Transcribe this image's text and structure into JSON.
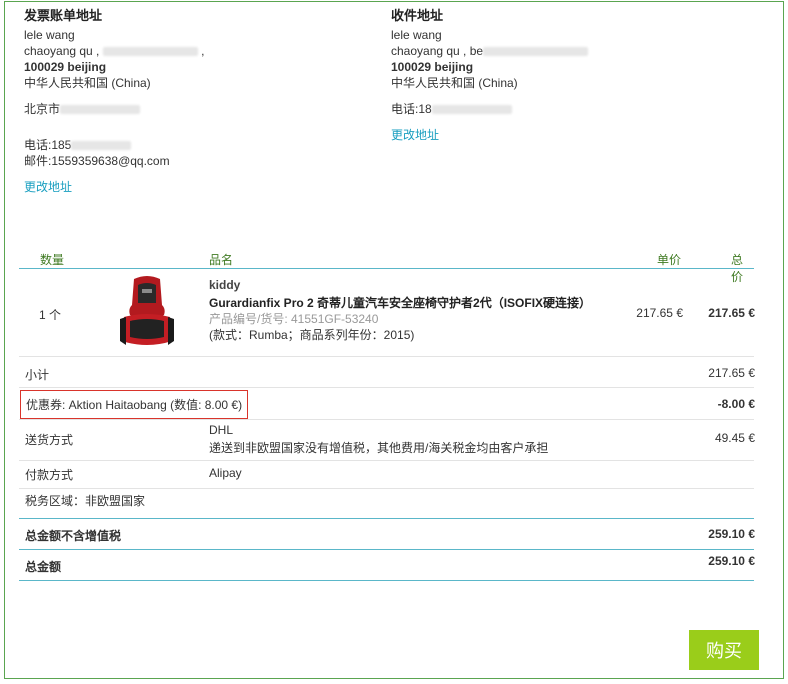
{
  "billing": {
    "title": "发票账单地址",
    "name": "lele wang",
    "street": "chaoyang qu , ",
    "street_tail": " ,",
    "postal_city": "100029 beijing",
    "country": "中华人民共和国 (China)",
    "local_address": "北京市",
    "phone": "电话:185",
    "email": "邮件:1559359638@qq.com",
    "edit_link": "更改地址"
  },
  "shipping": {
    "title": "收件地址",
    "name": "lele wang",
    "street": "chaoyang qu , be",
    "postal_city": "100029 beijing",
    "country": "中华人民共和国 (China)",
    "phone": "电话:18",
    "edit_link": "更改地址"
  },
  "table": {
    "headers": {
      "qty": "数量",
      "name": "品名",
      "unit_price": "单价",
      "total": "总价"
    },
    "product": {
      "qty": "1 个",
      "brand": "kiddy",
      "title": "Gurardianfix Pro 2 奇蒂儿童汽车安全座椅守护者2代（ISOFIX硬连接）",
      "sku": "产品编号/货号: 41551GF-53240",
      "variant": "(款式：Rumba；商品系列年份：2015)",
      "unit_price": "217.65 €",
      "total": "217.65 €"
    }
  },
  "summary": {
    "subtotal_label": "小计",
    "subtotal_value": "217.65 €",
    "coupon_label": "优惠券: Aktion Haitaobang (数值: 8.00 €)",
    "coupon_value": "-8.00 €",
    "shipping_label": "送货方式",
    "shipping_method": "DHL",
    "shipping_note": "递送到非欧盟国家没有增值税，其他费用/海关税金均由客户承担",
    "shipping_value": "49.45 €",
    "payment_label": "付款方式",
    "payment_method": "Alipay",
    "tax_zone": "税务区域：非欧盟国家",
    "net_label": "总金额不含增值税",
    "net_value": "259.10 €",
    "grand_label": "总金额",
    "grand_value": "259.10 €"
  },
  "buy_button": "购买",
  "colors": {
    "accent": "#1a9fc0",
    "header_green": "#3f7a22",
    "buy": "#9acd1a",
    "coupon_border": "#d9342b"
  }
}
